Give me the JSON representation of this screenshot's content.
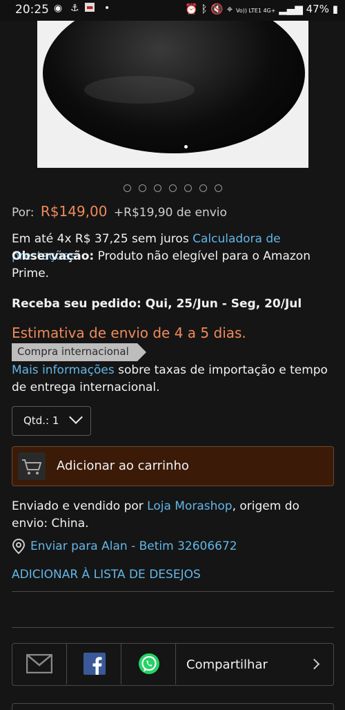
{
  "status_bar": {
    "time": "20:25",
    "network": "Vo)) LTE1 4G+",
    "battery": "47%"
  },
  "carousel": {
    "dot_count": 7
  },
  "price": {
    "prefix": "Por:",
    "amount": "R$149,00",
    "shipping": "+R$19,90 de envio"
  },
  "installments": {
    "text": "Em até 4x R$ 37,25 sem juros ",
    "link": "Calculadora de prestações"
  },
  "observation": {
    "label": "Observação:",
    "text": " Produto não elegível para o Amazon Prime."
  },
  "delivery": {
    "text": "Receba seu pedido: Qui, 25/Jun - Seg, 20/Jul"
  },
  "estimate": "Estimativa de envio de 4 a 5 dias.",
  "badge": "Compra internacional",
  "info": {
    "link": "Mais informações",
    "text": " sobre taxas de importação e tempo de entrega internacional."
  },
  "quantity": {
    "label": "Qtd.:",
    "value": "1"
  },
  "cart_button": "Adicionar ao carrinho",
  "seller": {
    "prefix": "Enviado e vendido por ",
    "name": "Loja Morashop",
    "suffix": ", origem do envio: China."
  },
  "ship_to": "Enviar para Alan - Betim 32606672",
  "wishlist": "ADICIONAR À LISTA DE DESEJOS",
  "share": {
    "label": "Compartilhar"
  },
  "colors": {
    "accent": "#f08b5b",
    "link": "#62b7e8",
    "cart_bg": "#3b1a08",
    "background": "#151515"
  }
}
